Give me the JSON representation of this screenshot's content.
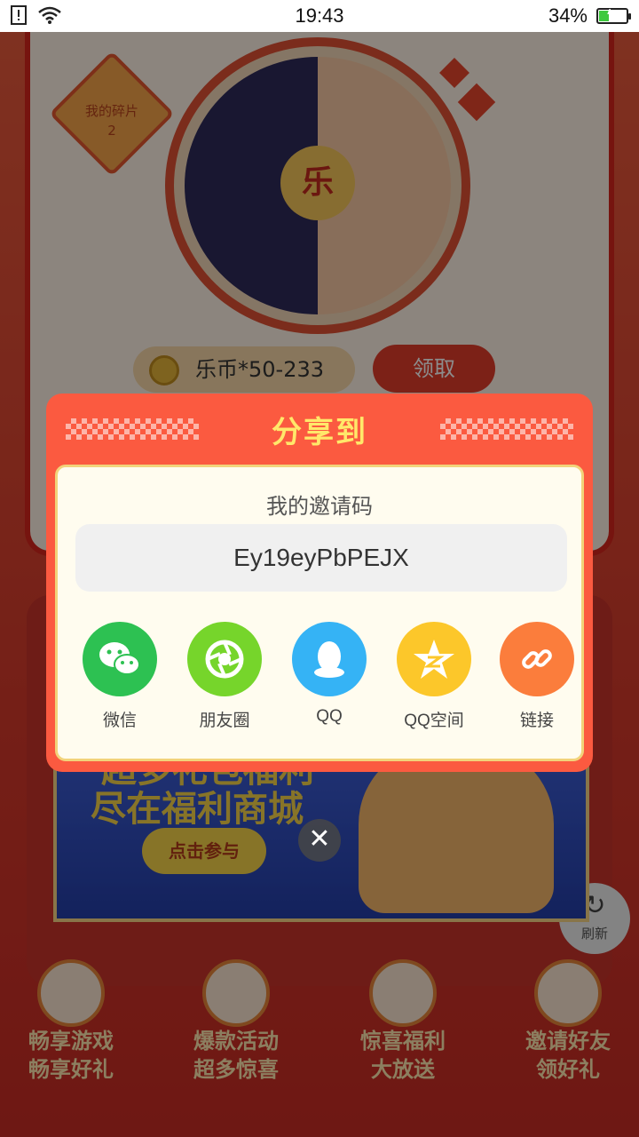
{
  "status_bar": {
    "time": "19:43",
    "battery": "34%",
    "battery_level": 0.34
  },
  "background": {
    "shard_label": "我的碎片",
    "shard_count": "2",
    "wheel_hub": "乐",
    "coin_text": "乐币*50-233",
    "claim_button": "领取",
    "banner_line1": "超多礼包福利",
    "banner_line2": "尽在福利商城",
    "banner_cta": "点击参与",
    "refresh": "刷新",
    "features": [
      {
        "line1": "畅享游戏",
        "line2": "畅享好礼"
      },
      {
        "line1": "爆款活动",
        "line2": "超多惊喜"
      },
      {
        "line1": "惊喜福利",
        "line2": "大放送"
      },
      {
        "line1": "邀请好友",
        "line2": "领好礼"
      }
    ]
  },
  "dialog": {
    "title": "分享到",
    "invite_label": "我的邀请码",
    "invite_code": "Ey19eyPbPEJX",
    "options": [
      {
        "label": "微信",
        "icon": "wechat-icon",
        "color": "#2dc152"
      },
      {
        "label": "朋友圈",
        "icon": "moments-icon",
        "color": "#76d52b"
      },
      {
        "label": "QQ",
        "icon": "qq-icon",
        "color": "#35b3f5"
      },
      {
        "label": "QQ空间",
        "icon": "qzone-icon",
        "color": "#fcc72a"
      },
      {
        "label": "链接",
        "icon": "link-icon",
        "color": "#fb7d3c"
      }
    ],
    "close": "✕"
  },
  "colors": {
    "dialog_bg": "#fb5a40",
    "title_text": "#ffe86a",
    "panel_bg": "#fffcef"
  }
}
